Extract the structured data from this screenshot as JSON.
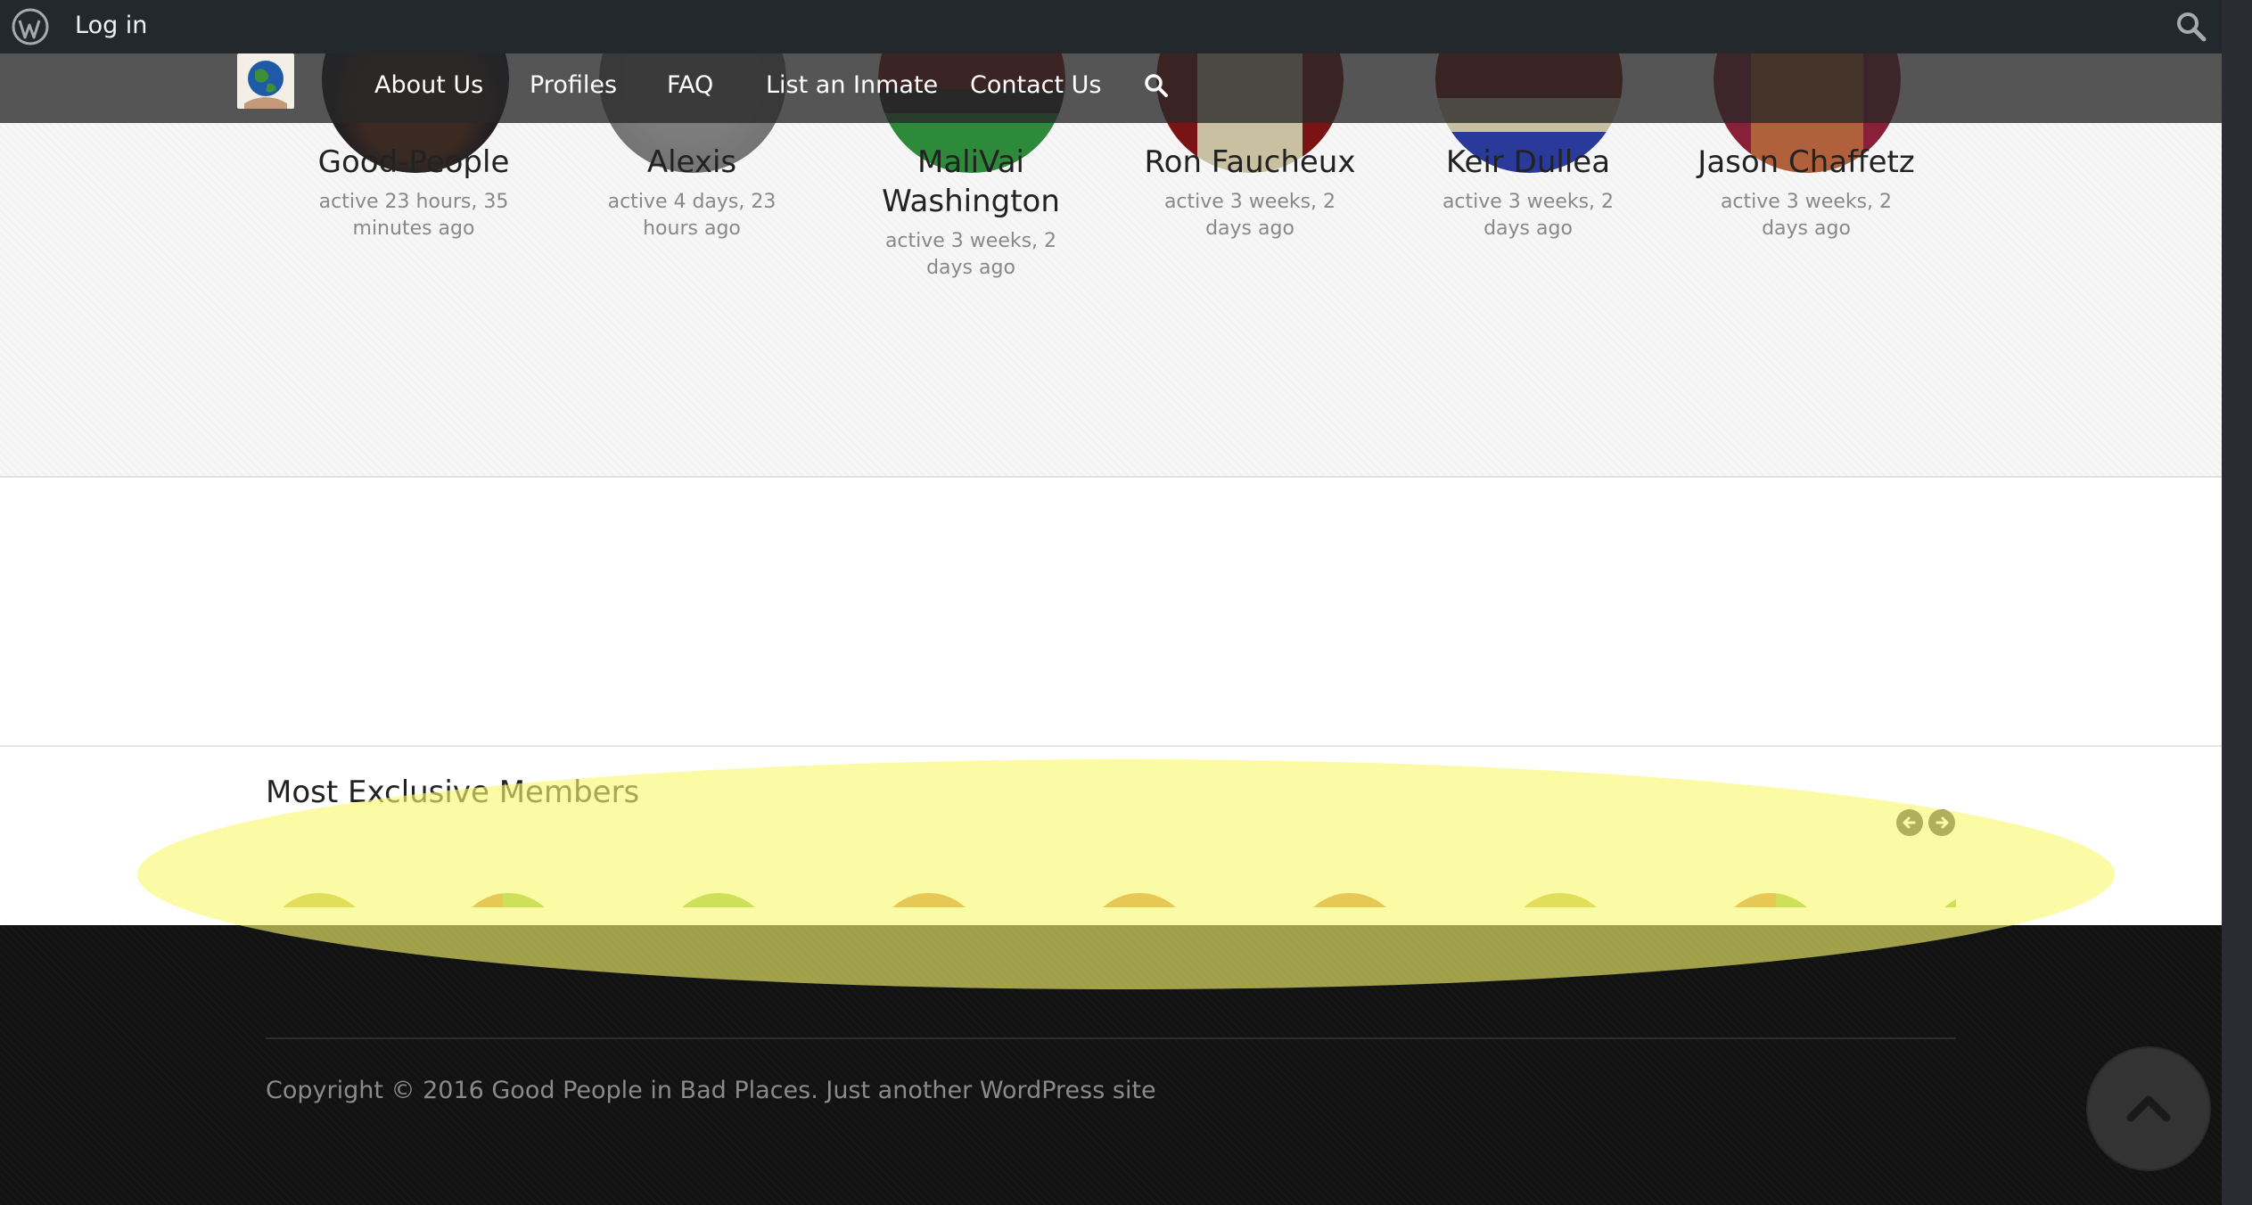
{
  "adminbar": {
    "login_label": "Log in",
    "wp_icon": "wordpress-logo-icon",
    "search_icon": "search-icon"
  },
  "nav": {
    "items": [
      "About Us",
      "Profiles",
      "FAQ",
      "List an Inmate",
      "Contact Us"
    ],
    "search_icon": "search-icon"
  },
  "members": [
    {
      "name": "Good-People",
      "active": "active 23 hours, 35 minutes ago"
    },
    {
      "name": "Alexis",
      "active": "active 4 days, 23 hours ago"
    },
    {
      "name": "MaliVai Washington",
      "active": "active 3 weeks, 2 days ago"
    },
    {
      "name": "Ron Faucheux",
      "active": "active 3 weeks, 2 days ago"
    },
    {
      "name": "Keir Dullea",
      "active": "active 3 weeks, 2 days ago"
    },
    {
      "name": "Jason Chaffetz",
      "active": "active 3 weeks, 2 days ago"
    }
  ],
  "exclusive": {
    "title": "Most Exclusive Members",
    "prev_icon": "arrow-left-circle-icon",
    "next_icon": "arrow-right-circle-icon"
  },
  "footer": {
    "copyright": "Copyright © 2016 Good People in Bad Places. Just another WordPress site",
    "back_to_top_icon": "chevron-up-icon"
  },
  "colors": {
    "admin_bar": "#23282d",
    "nav_overlay": "#3c3c3c",
    "footer_bg": "#121212",
    "highlight": "#faf86e",
    "avatar_orange": "#c87a2a",
    "avatar_green": "#86b83a",
    "avatar_olive": "#b9b33a"
  }
}
